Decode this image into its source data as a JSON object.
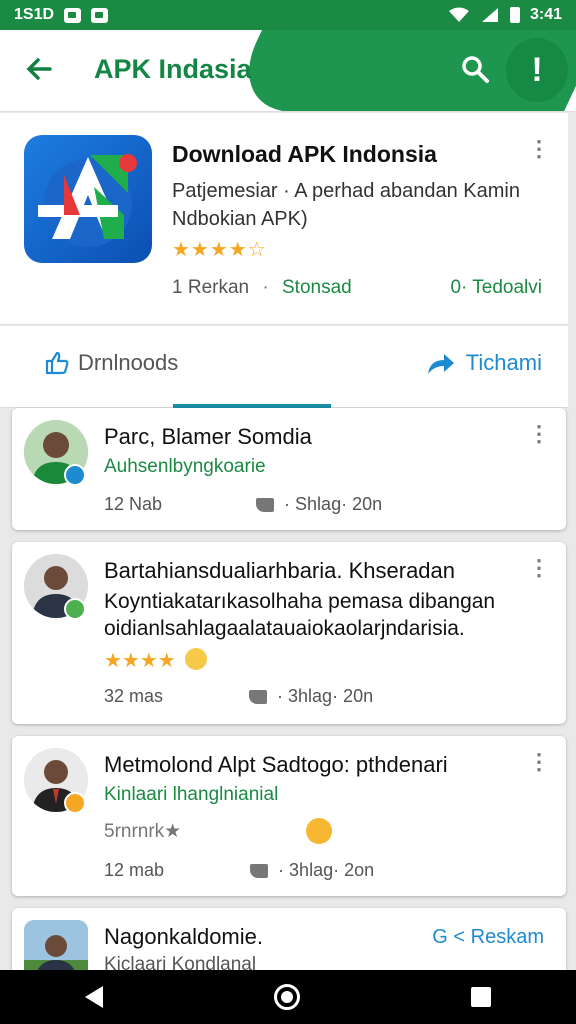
{
  "status": {
    "time_left": "1S1D",
    "time_right": "3:41"
  },
  "appbar": {
    "title": "APK Indasia"
  },
  "app": {
    "name": "Download APK Indonsia",
    "description": "Patjemesiar · A perhad abandan Kamin Ndbokian APK)",
    "rating_text": "★★★★☆",
    "downloads": "1 Rerkan",
    "separator": "·",
    "status": "Stonsad",
    "right_label": "0· Tedoalvi"
  },
  "tabs": {
    "left_label": "Drnlnoods",
    "right_label": "Tichami"
  },
  "reviews": [
    {
      "name": "Parc, Blamer Somdia",
      "sub": "Auhsenlbyngkoarie",
      "body": "",
      "rating": "",
      "time": "12 Nab",
      "likes": "· Shlag· 20n"
    },
    {
      "name": "Bartahiansdualiarhbaria. Khseradan",
      "sub": "",
      "body": "Koyntiakatarıkasolhaha pemasa dibangan oidianlsahlagaalatauaiokaolarjndarisia.",
      "rating": "★★★★",
      "time": "32 mas",
      "likes": "· 3hlag· 20n"
    },
    {
      "name": "Metmolond Alpt Sadtogo: pthdenari",
      "sub": "Kinlaari lhanglnianial",
      "body": "",
      "rating": "5rnrnrk★",
      "time": "12 mab",
      "likes": "· 3hlag· 2on"
    },
    {
      "name": "Nagonkaldomie.",
      "sub": "Kiclaari Kondlanal",
      "body": "",
      "rating": "",
      "time": "",
      "likes": "",
      "action": "G < Reskam"
    }
  ],
  "colors": {
    "brand_green": "#1b8a43",
    "accent_blue": "#1d8ad1",
    "star": "#f5a623"
  }
}
